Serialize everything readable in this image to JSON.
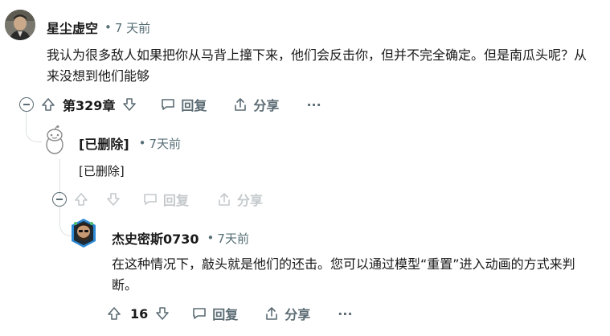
{
  "comments": [
    {
      "username": "星尘虚空",
      "sep": "•",
      "time": "7 天前",
      "body": "我认为很多敌人如果把你从马背上撞下来，他们会反击你，但并不完全确定。但是南瓜头呢？从来没想到他们能够",
      "vote_count": "第329章",
      "reply_label": "回复",
      "share_label": "分享",
      "more_label": "···"
    },
    {
      "username": "[已删除]",
      "sep": "•",
      "time": "7天前",
      "body": "[已删除]",
      "reply_label": "回复",
      "share_label": "分享"
    },
    {
      "username": "杰史密斯0730",
      "sep": "•",
      "time": "7天前",
      "body": "在这种情况下，敲头就是他们的还击。您可以通过模型“重置”进入动画的方式来判断。",
      "vote_count": "16",
      "reply_label": "回复",
      "share_label": "分享",
      "more_label": "···"
    }
  ],
  "icons": {
    "collapse": "collapse-icon",
    "upvote": "upvote-arrow-icon",
    "downvote": "downvote-arrow-icon",
    "reply": "reply-bubble-icon",
    "share": "share-icon",
    "more": "more-dots-icon"
  },
  "colors": {
    "text": "#1a1a1b",
    "meta": "#576f76",
    "action": "#5c6c74",
    "disabled": "#c4c9cc",
    "thread": "#dbe0e2"
  }
}
